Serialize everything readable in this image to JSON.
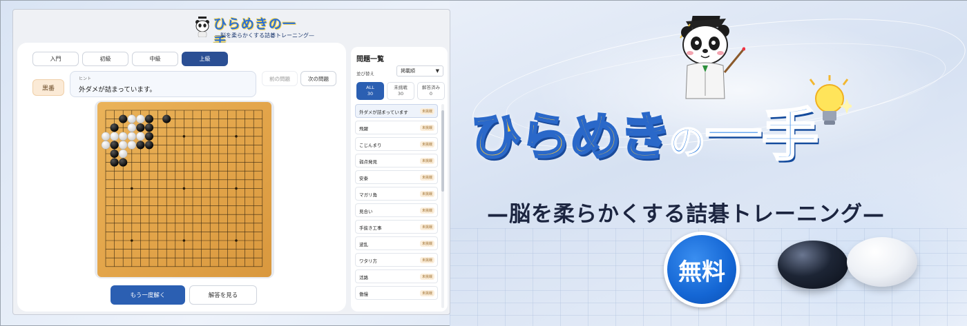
{
  "app": {
    "logo_title": "ひらめきの一手",
    "logo_subtitle": "—脳を柔らかくする詰碁トレーニング—",
    "level_tabs": [
      {
        "label": "入門",
        "active": false
      },
      {
        "label": "初級",
        "active": false
      },
      {
        "label": "中級",
        "active": false
      },
      {
        "label": "上級",
        "active": true
      }
    ],
    "turn": "黒番",
    "hint_label": "ヒント",
    "hint_text": "外ダメが詰まっています。",
    "prev_button": "前の問題",
    "next_button": "次の問題",
    "retry_button": "もう一度解く",
    "answer_button": "解答を見る",
    "board": {
      "size": 19,
      "star_points": [
        [
          3,
          3
        ],
        [
          9,
          3
        ],
        [
          15,
          3
        ],
        [
          3,
          9
        ],
        [
          9,
          9
        ],
        [
          15,
          9
        ],
        [
          3,
          15
        ],
        [
          9,
          15
        ],
        [
          15,
          15
        ]
      ],
      "black": [
        [
          2,
          1
        ],
        [
          5,
          1
        ],
        [
          7,
          1
        ],
        [
          1,
          2
        ],
        [
          4,
          2
        ],
        [
          5,
          2
        ],
        [
          3,
          2
        ],
        [
          5,
          3
        ],
        [
          0,
          4
        ],
        [
          1,
          4
        ],
        [
          4,
          4
        ],
        [
          5,
          4
        ],
        [
          1,
          5
        ],
        [
          1,
          6
        ],
        [
          2,
          6
        ],
        [
          3,
          1
        ]
      ],
      "white": [
        [
          3,
          1
        ],
        [
          4,
          1
        ],
        [
          3,
          2
        ],
        [
          4,
          3
        ],
        [
          3,
          3
        ],
        [
          0,
          3
        ],
        [
          1,
          3
        ],
        [
          2,
          3
        ],
        [
          2,
          4
        ],
        [
          3,
          4
        ],
        [
          0,
          4
        ],
        [
          2,
          5
        ]
      ]
    },
    "colors": {
      "accent": "#2b5fb2",
      "active_tab": "#2b4f94",
      "board": "#e3a54a"
    }
  },
  "problem_list": {
    "title": "問題一覧",
    "sort_label": "並び替え",
    "sort_value": "掲載順",
    "filters": [
      {
        "label": "ALL",
        "count": "30",
        "active": true
      },
      {
        "label": "未挑戦",
        "count": "30",
        "active": false
      },
      {
        "label": "解答済み",
        "count": "0",
        "active": false
      }
    ],
    "status_badge": "未挑戦",
    "items": [
      {
        "title": "外ダメが詰まっています",
        "active": true
      },
      {
        "title": "飛躍",
        "active": false
      },
      {
        "title": "こじんまり",
        "active": false
      },
      {
        "title": "弱点発見",
        "active": false
      },
      {
        "title": "安泰",
        "active": false
      },
      {
        "title": "マガリ角",
        "active": false
      },
      {
        "title": "見合い",
        "active": false
      },
      {
        "title": "手抜き工事",
        "active": false
      },
      {
        "title": "波乱",
        "active": false
      },
      {
        "title": "ワタリ方",
        "active": false
      },
      {
        "title": "活路",
        "active": false
      },
      {
        "title": "傲慢",
        "active": false
      }
    ]
  },
  "promo": {
    "title_hira": "ひらめき",
    "title_no": "の",
    "title_kanji": "一手",
    "subtitle": "—脳を柔らかくする詰碁トレーニング—",
    "free_badge": "無料"
  }
}
